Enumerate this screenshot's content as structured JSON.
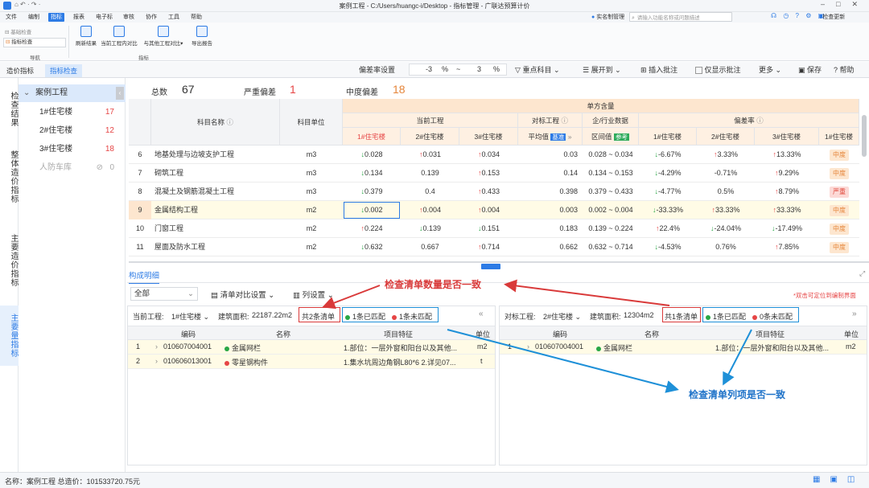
{
  "window": {
    "title": "案例工程 - C:/Users/huangc-i/Desktop - 指标管理 - 广联达预算计价",
    "realname": "实名制管理",
    "search_placeholder": "请输入功能名称或问题描述",
    "upgrade": "检查更新"
  },
  "menu": [
    "文件",
    "编制",
    "指标",
    "报表",
    "电子标",
    "审核",
    "协作",
    "工具",
    "帮助"
  ],
  "ribbon": {
    "nav_items": [
      "基础检查",
      "指标检查"
    ],
    "nav_group": "导航",
    "buttons": [
      "刷新结果",
      "当前工程内对比",
      "与其他工程对比",
      "导出报告"
    ],
    "index_group": "指标"
  },
  "tabs": [
    "造价指标",
    "指标检查"
  ],
  "toolbar": {
    "deviation_label": "偏差率设置",
    "low": "-3",
    "pct1": "%",
    "tilde": "~",
    "high": "3",
    "pct2": "%",
    "key_subject": "重点科目",
    "expand": "展开到",
    "insert_note": "插入批注",
    "show_note_only": "仅显示批注",
    "more": "更多",
    "save": "保存",
    "help": "帮助"
  },
  "rail": [
    "检查结果",
    "整体造价指标",
    "主要造价指标",
    "主要量指标"
  ],
  "tree": {
    "root": "案例工程",
    "items": [
      {
        "name": "1#住宅楼",
        "count": "17"
      },
      {
        "name": "2#住宅楼",
        "count": "12"
      },
      {
        "name": "3#住宅楼",
        "count": "18"
      },
      {
        "name": "人防车库",
        "count": "0"
      }
    ]
  },
  "summary": {
    "total_label": "总数",
    "total": "67",
    "severe_label": "严重偏差",
    "severe": "1",
    "mid_label": "中度偏差",
    "mid": "18"
  },
  "grid": {
    "h_name": "科目名称",
    "h_unit": "科目单位",
    "h_single": "单方含量",
    "h_current": "当前工程",
    "h_compare": "对标工程",
    "h_industry": "企/行业数据",
    "h_dev": "偏差率",
    "c1": "1#住宅楼",
    "c2": "2#住宅楼",
    "c3": "3#住宅楼",
    "avg": "平均值",
    "base": "基准",
    "interval": "区间值",
    "ref": "参考",
    "d1": "1#住宅楼",
    "d2": "2#住宅楼",
    "d3": "3#住宅楼",
    "d4": "1#住宅楼",
    "rows": [
      {
        "no": "6",
        "name": "地基处理与边坡支护工程",
        "unit": "m3",
        "v1": "0.028",
        "a1": "dn",
        "v2": "0.031",
        "a2": "up",
        "v3": "0.034",
        "a3": "up",
        "avg": "0.03",
        "range": "0.028 ~ 0.034",
        "p1": "-6.67%",
        "b1": "dn",
        "p2": "3.33%",
        "b2": "up",
        "p3": "13.33%",
        "b3": "up",
        "lvl": "中度",
        "lc": "mid"
      },
      {
        "no": "7",
        "name": "砌筑工程",
        "unit": "m3",
        "v1": "0.134",
        "a1": "dn",
        "v2": "0.139",
        "a2": "",
        "v3": "0.153",
        "a3": "up",
        "avg": "0.14",
        "range": "0.134 ~ 0.153",
        "p1": "-4.29%",
        "b1": "dn",
        "p2": "-0.71%",
        "b2": "",
        "p3": "9.29%",
        "b3": "up",
        "lvl": "中度",
        "lc": "mid"
      },
      {
        "no": "8",
        "name": "混凝土及钢筋混凝土工程",
        "unit": "m3",
        "v1": "0.379",
        "a1": "dn",
        "v2": "0.4",
        "a2": "",
        "v3": "0.433",
        "a3": "up",
        "avg": "0.398",
        "range": "0.379 ~ 0.433",
        "p1": "-4.77%",
        "b1": "dn",
        "p2": "0.5%",
        "b2": "",
        "p3": "8.79%",
        "b3": "up",
        "lvl": "严重",
        "lc": "high"
      },
      {
        "no": "9",
        "name": "金属结构工程",
        "unit": "m2",
        "v1": "0.002",
        "a1": "dn",
        "v2": "0.004",
        "a2": "up",
        "v3": "0.004",
        "a3": "up",
        "avg": "0.003",
        "range": "0.002 ~ 0.004",
        "p1": "-33.33%",
        "b1": "dn",
        "p2": "33.33%",
        "b2": "up",
        "p3": "33.33%",
        "b3": "up",
        "lvl": "中度",
        "lc": "mid"
      },
      {
        "no": "10",
        "name": "门窗工程",
        "unit": "m2",
        "v1": "0.224",
        "a1": "up",
        "v2": "0.139",
        "a2": "dn",
        "v3": "0.151",
        "a3": "dn",
        "avg": "0.183",
        "range": "0.139 ~ 0.224",
        "p1": "22.4%",
        "b1": "up",
        "p2": "-24.04%",
        "b2": "dn",
        "p3": "-17.49%",
        "b3": "dn",
        "lvl": "中度",
        "lc": "mid"
      },
      {
        "no": "11",
        "name": "屋面及防水工程",
        "unit": "m2",
        "v1": "0.632",
        "a1": "dn",
        "v2": "0.667",
        "a2": "",
        "v3": "0.714",
        "a3": "up",
        "avg": "0.662",
        "range": "0.632 ~ 0.714",
        "p1": "-4.53%",
        "b1": "dn",
        "p2": "0.76%",
        "b2": "",
        "p3": "7.85%",
        "b3": "up",
        "lvl": "中度",
        "lc": "mid"
      }
    ]
  },
  "lower": {
    "title": "构成明细",
    "filter": "全部",
    "compare_setting": "清单对比设置",
    "col_setting": "列设置",
    "dbl_hint": "*双击可定位到编制界面",
    "left": {
      "project_label": "当前工程:",
      "project": "1#住宅楼",
      "area_label": "建筑面积:",
      "area": "22187.22m2",
      "count": "共2条清单",
      "matched": "1条已匹配",
      "unmatched": "1条未匹配",
      "cols": [
        "编码",
        "名称",
        "项目特征",
        "单位"
      ],
      "rows": [
        {
          "no": "1",
          "code": "010607004001",
          "name": "金属网栏",
          "dot": "green",
          "feature": "1.部位：一层外窗和阳台以及其他...",
          "unit": "m2"
        },
        {
          "no": "2",
          "code": "010606013001",
          "name": "零星钢构件",
          "dot": "red",
          "feature": "1.集水坑周边角钢L80*6 2.详见07...",
          "unit": "t"
        }
      ]
    },
    "right": {
      "project_label": "对标工程:",
      "project": "2#住宅楼",
      "area_label": "建筑面积:",
      "area": "12304m2",
      "count": "共1条清单",
      "matched": "1条已匹配",
      "unmatched": "0条未匹配",
      "cols": [
        "编码",
        "名称",
        "项目特征",
        "单位"
      ],
      "rows": [
        {
          "no": "1",
          "code": "010607004001",
          "name": "金属网栏",
          "dot": "green",
          "feature": "1.部位：一层外窗和阳台以及其他...",
          "unit": "m2"
        }
      ]
    }
  },
  "annotations": {
    "a1": "检查清单数量是否一致",
    "a2": "检查清单列项是否一致"
  },
  "status": {
    "text": "名称：案例工程   总造价：101533720.75元"
  },
  "colors": {
    "accent": "#2d7be5",
    "up": "#e64545",
    "down": "#28a745",
    "annot": "#d93a3a"
  }
}
